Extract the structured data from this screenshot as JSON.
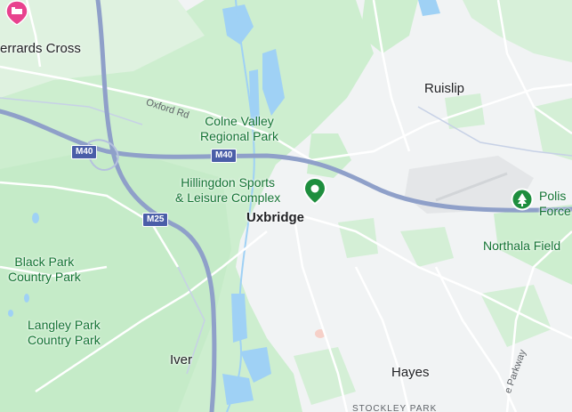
{
  "map": {
    "places": {
      "gerrards_cross": "errards Cross",
      "ruislip": "Ruislip",
      "uxbridge": "Uxbridge",
      "iver": "Iver",
      "hayes": "Hayes",
      "stockley_park": "STOCKLEY PARK"
    },
    "parks": {
      "colne_valley_1": "Colne Valley",
      "colne_valley_2": "Regional Park",
      "hillingdon_1": "Hillingdon Sports",
      "hillingdon_2": "& Leisure Complex",
      "black_park_1": "Black Park",
      "black_park_2": "Country Park",
      "langley_park_1": "Langley Park",
      "langley_park_2": "Country Park",
      "northala": "Northala Field",
      "polish_1": "Polis",
      "polish_2": "Force"
    },
    "roads": {
      "oxford_rd": "Oxford Rd",
      "parkway": "e Parkway"
    },
    "shields": {
      "m40_left": "M40",
      "m40_mid": "M40",
      "m25": "M25"
    },
    "colors": {
      "background": "#f1f3f4",
      "park_green": "#cdeecf",
      "water": "#9fd1f5",
      "motorway": "#8fa0c9",
      "pin_green": "#1e8e3e",
      "hotel_pink": "#e8428e"
    },
    "icons": {
      "hotel": "hotel-icon",
      "park_pin": "park-pin-icon",
      "tree_pin": "tree-pin-icon"
    }
  }
}
